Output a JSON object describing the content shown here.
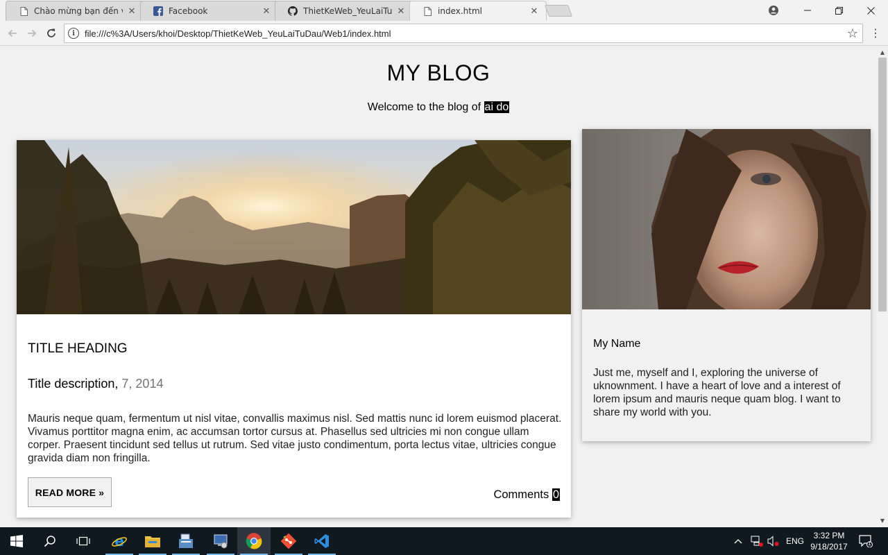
{
  "browser": {
    "tabs": [
      {
        "title": "Chào mừng bạn đến với",
        "icon": "page-icon",
        "active": false
      },
      {
        "title": "Facebook",
        "icon": "facebook-icon",
        "active": false
      },
      {
        "title": "ThietKeWeb_YeuLaiTuDau",
        "icon": "github-icon",
        "active": false
      },
      {
        "title": "index.html",
        "icon": "page-icon",
        "active": true
      }
    ],
    "url": "file:///c%3A/Users/khoi/Desktop/ThietKeWeb_YeuLaiTuDau/Web1/index.html",
    "accent": "#1a73e8"
  },
  "page": {
    "title": "MY BLOG",
    "welcome_prefix": "Welcome to the blog of ",
    "welcome_name": "ai do",
    "post": {
      "heading": "TITLE HEADING",
      "description": "Title description,",
      "date": "7, 2014",
      "body": "Mauris neque quam, fermentum ut nisl vitae, convallis maximus nisl. Sed mattis nunc id lorem euismod placerat. Vivamus porttitor magna enim, ac accumsan tortor cursus at. Phasellus sed ultricies mi non congue ullam corper. Praesent tincidunt sed tellus ut rutrum. Sed vitae justo condimentum, porta lectus vitae, ultricies congue gravida diam non fringilla.",
      "read_more": "READ MORE »",
      "comments_label": "Comments",
      "comments_count": "0"
    },
    "profile": {
      "name": "My Name",
      "bio": "Just me, myself and I, exploring the universe of uknownment. I have a heart of love and a interest of lorem ipsum and mauris neque quam blog. I want to share my world with you."
    }
  },
  "taskbar": {
    "apps": [
      "start-icon",
      "search-icon",
      "task-view-icon",
      "internet-explorer-icon",
      "file-explorer-icon",
      "documents-icon",
      "setup-icon",
      "chrome-icon",
      "git-icon",
      "visual-studio-icon"
    ],
    "language": "ENG",
    "time": "3:32 PM",
    "date": "9/18/2017",
    "notifications": "1"
  }
}
